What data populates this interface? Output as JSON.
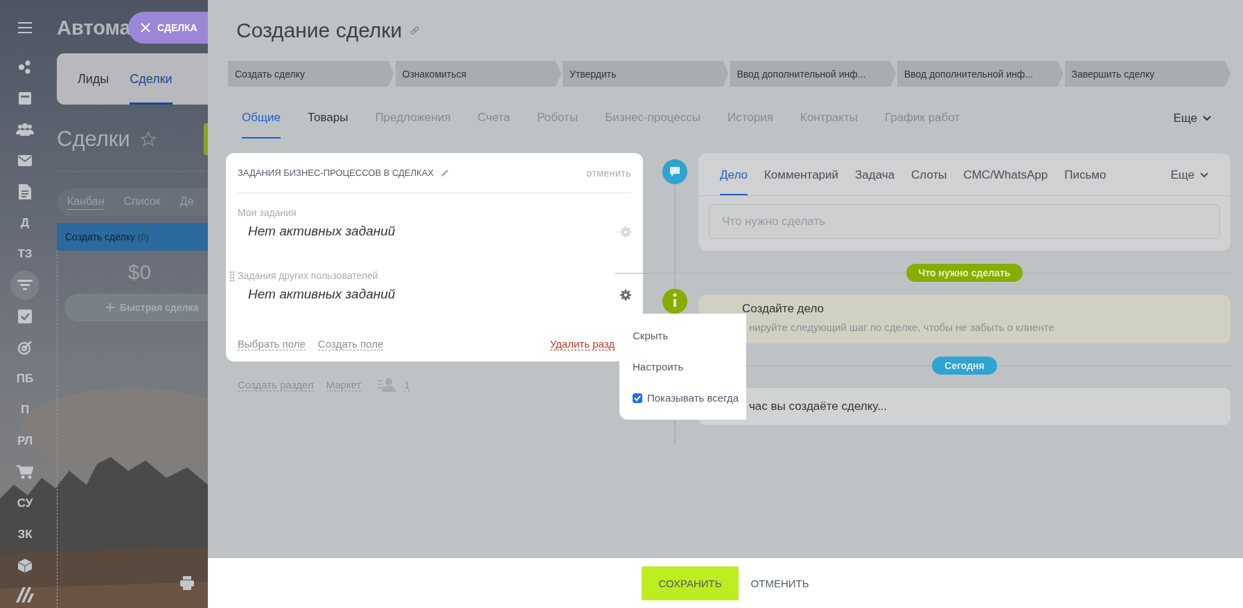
{
  "sidebar": {
    "items": [
      {
        "kind": "share",
        "selected": false
      },
      {
        "kind": "calendar",
        "selected": false
      },
      {
        "kind": "contacts",
        "selected": false
      },
      {
        "kind": "mail",
        "selected": false
      },
      {
        "kind": "document",
        "selected": false
      },
      {
        "kind": "letters",
        "label": "Д",
        "selected": false
      },
      {
        "kind": "letters",
        "label": "ТЗ",
        "selected": false
      },
      {
        "kind": "filter",
        "selected": true
      },
      {
        "kind": "task",
        "selected": false
      },
      {
        "kind": "target",
        "selected": false
      },
      {
        "kind": "letters",
        "label": "ПБ",
        "selected": false
      },
      {
        "kind": "letters",
        "label": "П",
        "selected": false
      },
      {
        "kind": "letters",
        "label": "РЛ",
        "selected": false
      },
      {
        "kind": "cart",
        "selected": false
      },
      {
        "kind": "letters",
        "label": "СУ",
        "selected": false
      },
      {
        "kind": "letters",
        "label": "ЗК",
        "selected": false
      },
      {
        "kind": "box",
        "selected": false
      },
      {
        "kind": "logo",
        "selected": false
      }
    ]
  },
  "background_page": {
    "title": "Автома",
    "badge": "СДЕЛКА",
    "entity_tabs": [
      {
        "label": "Лиды",
        "selected": false
      },
      {
        "label": "Сделки",
        "selected": true
      }
    ],
    "heading": "Сделки",
    "view_tabs": [
      {
        "label": "Канбан",
        "selected": true
      },
      {
        "label": "Список",
        "selected": false
      },
      {
        "label": "Де",
        "selected": false
      }
    ],
    "column": {
      "title": "Создать сделку",
      "count": "(0)",
      "total": "$0",
      "quick_add": "Быстрая сделка"
    }
  },
  "slider": {
    "title": "Создание сделки",
    "stages": [
      "Создать сделку",
      "Ознакомиться",
      "Утвердить",
      "Ввод дополнительной инф...",
      "Ввод дополнительной инф...",
      "Завершить сделку"
    ],
    "tabs": [
      {
        "label": "Общие",
        "selected": true,
        "disabled": false
      },
      {
        "label": "Товары",
        "selected": false,
        "disabled": false
      },
      {
        "label": "Предложения",
        "selected": false,
        "disabled": true
      },
      {
        "label": "Счета",
        "selected": false,
        "disabled": true
      },
      {
        "label": "Роботы",
        "selected": false,
        "disabled": true
      },
      {
        "label": "Бизнес-процессы",
        "selected": false,
        "disabled": true
      },
      {
        "label": "История",
        "selected": false,
        "disabled": true
      },
      {
        "label": "Контракты",
        "selected": false,
        "disabled": true
      },
      {
        "label": "График работ",
        "selected": false,
        "disabled": true
      }
    ],
    "more": "Еще",
    "card": {
      "title": "ЗАДАНИЯ БИЗНЕС-ПРОЦЕССОВ В СДЕЛКАХ",
      "cancel": "отменить",
      "sections": [
        {
          "label": "Мои задания",
          "value": "Нет активных заданий",
          "hovered": false
        },
        {
          "label": "Задания других пользователей",
          "value": "Нет активных заданий",
          "hovered": true
        }
      ],
      "links": [
        "Выбрать поле",
        "Создать поле"
      ],
      "delete_link": "Удалить разд"
    },
    "below_links": [
      "Создать раздел",
      "Маркет"
    ],
    "users_count": "1",
    "menu": {
      "items": [
        {
          "kind": "action",
          "label": "Скрыть"
        },
        {
          "kind": "action",
          "label": "Настроить"
        },
        {
          "kind": "checkbox",
          "label": "Показывать всегда",
          "checked": true
        }
      ]
    },
    "activity": {
      "tabs": [
        {
          "label": "Дело",
          "selected": true
        },
        {
          "label": "Комментарий",
          "selected": false
        },
        {
          "label": "Задача",
          "selected": false
        },
        {
          "label": "Слоты",
          "selected": false
        },
        {
          "label": "СМС/WhatsApp",
          "selected": false
        },
        {
          "label": "Письмо",
          "selected": false
        }
      ],
      "more": "Еще",
      "placeholder": "Что нужно сделать"
    },
    "timeline": {
      "todo_badge": "Что нужно сделать",
      "hint_title": "Создайте дело",
      "hint_text": "нируйте следующий шаг по сделке, чтобы не забыть о клиенте",
      "today_badge": "Сегодня",
      "current": "час вы создаёте сделку..."
    },
    "footer": {
      "save": "СОХРАНИТЬ",
      "cancel": "ОТМЕНИТЬ"
    }
  }
}
